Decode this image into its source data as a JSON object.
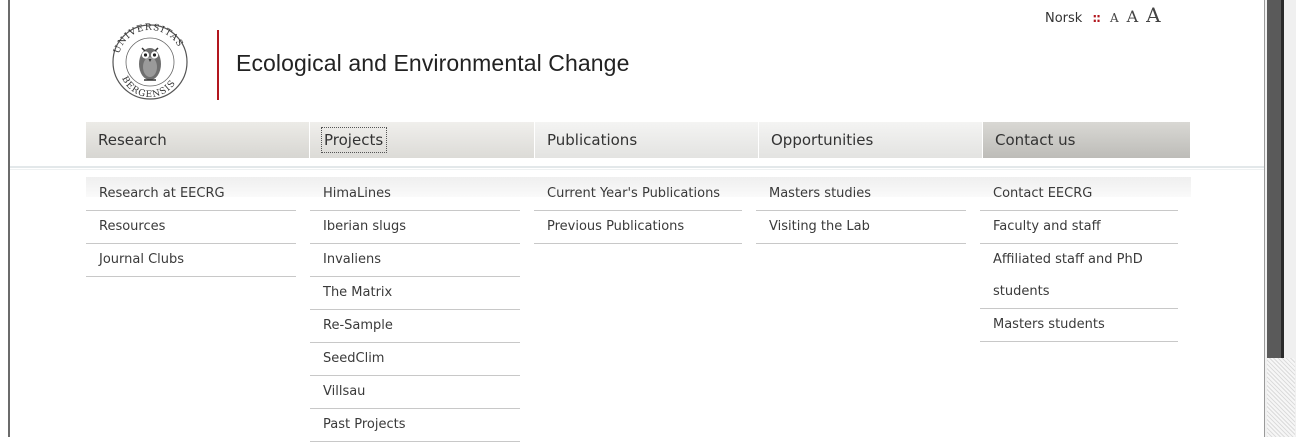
{
  "utility": {
    "language_link": "Norsk",
    "separator": "::",
    "font_size_small": "A",
    "font_size_medium": "A",
    "font_size_large": "A"
  },
  "header": {
    "logo_text_top": "UNIVERSITAS",
    "logo_text_bottom": "BERGENSIS",
    "site_title": "Ecological and Environmental Change"
  },
  "nav": [
    {
      "label": "Research",
      "items": [
        "Research at EECRG",
        "Resources",
        "Journal Clubs"
      ]
    },
    {
      "label": "Projects",
      "items": [
        "HimaLines",
        "Iberian slugs",
        "Invaliens",
        "The Matrix",
        "Re-Sample",
        "SeedClim",
        "Villsau",
        "Past Projects"
      ]
    },
    {
      "label": "Publications",
      "items": [
        "Current Year's Publications",
        "Previous Publications"
      ]
    },
    {
      "label": "Opportunities",
      "items": [
        "Masters studies",
        "Visiting the Lab"
      ]
    },
    {
      "label": "Contact us",
      "items": [
        "Contact EECRG",
        "Faculty and staff",
        "Affiliated staff and PhD students",
        "Masters students"
      ]
    }
  ],
  "colors": {
    "accent": "#b2171e",
    "text": "#333333"
  }
}
